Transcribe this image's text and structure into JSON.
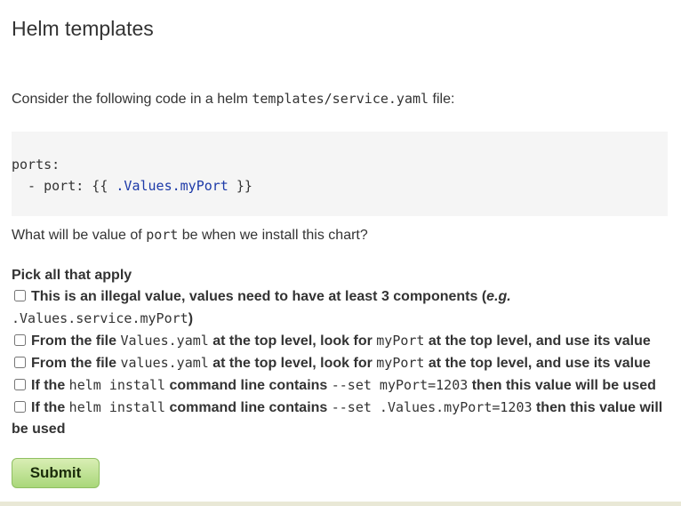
{
  "heading": "Helm templates",
  "intro": {
    "before": "Consider the following code in a helm ",
    "code": "templates/service.yaml",
    "after": " file:"
  },
  "codeblock": {
    "line1": "ports:",
    "line2_prefix": "  - port: {{ ",
    "line2_value": ".Values.myPort",
    "line2_suffix": " }}"
  },
  "question": {
    "before": "What will be value of ",
    "code": "port",
    "after": " be when we install this chart?"
  },
  "pick_label": "Pick all that apply",
  "options": [
    {
      "t1": "This is an illegal value, values need to have at least 3 components (",
      "t2": "e.g.",
      "code": ".Values.service.myPort",
      "t3": ")"
    },
    {
      "t1": "From the file ",
      "code1": "Values.yaml",
      "t2": " at the top level, look for ",
      "code2": "myPort",
      "t3": " at the top level, and use its value"
    },
    {
      "t1": "From the file ",
      "code1": "values.yaml",
      "t2": " at the top level, look for ",
      "code2": "myPort",
      "t3": " at the top level, and use its value"
    },
    {
      "t1": "If the ",
      "code1": "helm install",
      "t2": " command line contains ",
      "code2": "--set myPort=1203",
      "t3": " then this value will be used"
    },
    {
      "t1": "If the ",
      "code1": "helm install",
      "t2": " command line contains ",
      "code2": "--set .Values.myPort=1203",
      "t3": " then this value will be used"
    }
  ],
  "submit_label": "Submit"
}
